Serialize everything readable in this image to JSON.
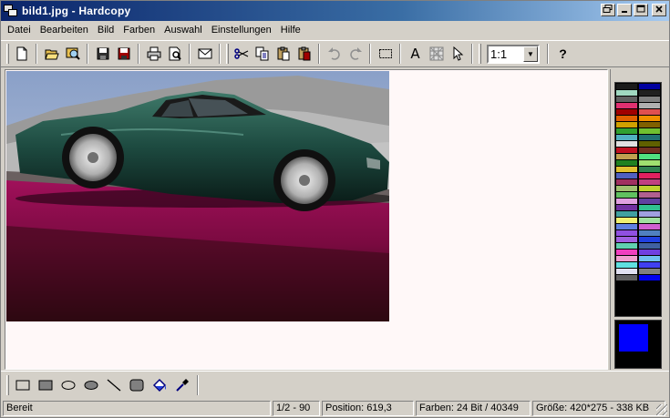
{
  "window": {
    "title": "bild1.jpg - Hardcopy",
    "icons": [
      "restore-icon",
      "minimize-icon",
      "maximize-icon",
      "close-icon"
    ]
  },
  "menu": {
    "items": [
      "Datei",
      "Bearbeiten",
      "Bild",
      "Farben",
      "Auswahl",
      "Einstellungen",
      "Hilfe"
    ]
  },
  "toolbar": {
    "zoom_value": "1:1",
    "text_tool_label": "A",
    "help_label": "?"
  },
  "palette": {
    "colors": [
      "#1a1a1a",
      "#0000a0",
      "#a0d8c0",
      "#202020",
      "#606060",
      "#808080",
      "#e03070",
      "#b0b0b0",
      "#a00000",
      "#e05050",
      "#e06000",
      "#f09000",
      "#d0a000",
      "#806000",
      "#30a030",
      "#70c030",
      "#50b0c0",
      "#207070",
      "#e0e0e0",
      "#606000",
      "#c01020",
      "#703020",
      "#c0a050",
      "#50e080",
      "#208020",
      "#a0e070",
      "#e0c030",
      "#308050",
      "#5060c0",
      "#e02060",
      "#a03060",
      "#c04080",
      "#a0c070",
      "#c0d030",
      "#60c060",
      "#b06090",
      "#e0a0e0",
      "#6040a0",
      "#7030a0",
      "#30c090",
      "#40a0a0",
      "#a0a0e0",
      "#f0f070",
      "#a0e0a0",
      "#6080e0",
      "#d060d0",
      "#9050e0",
      "#5080c0",
      "#a060e0",
      "#2040e0",
      "#60d0b0",
      "#4060a0",
      "#f040c0",
      "#7040e0",
      "#f0a0d0",
      "#70c0f0",
      "#60e0e0",
      "#4040f0",
      "#e0e0f0",
      "#808080",
      "#606060",
      "#0000f0"
    ],
    "foreground": "#0000ff",
    "background": "#000000"
  },
  "status": {
    "ready": "Bereit",
    "page": "1/2 - 90",
    "position": "Position: 619,3",
    "colors": "Farben: 24 Bit / 40349",
    "size": "Größe: 420*275  -  338 KB"
  },
  "accent": "#0a246a"
}
